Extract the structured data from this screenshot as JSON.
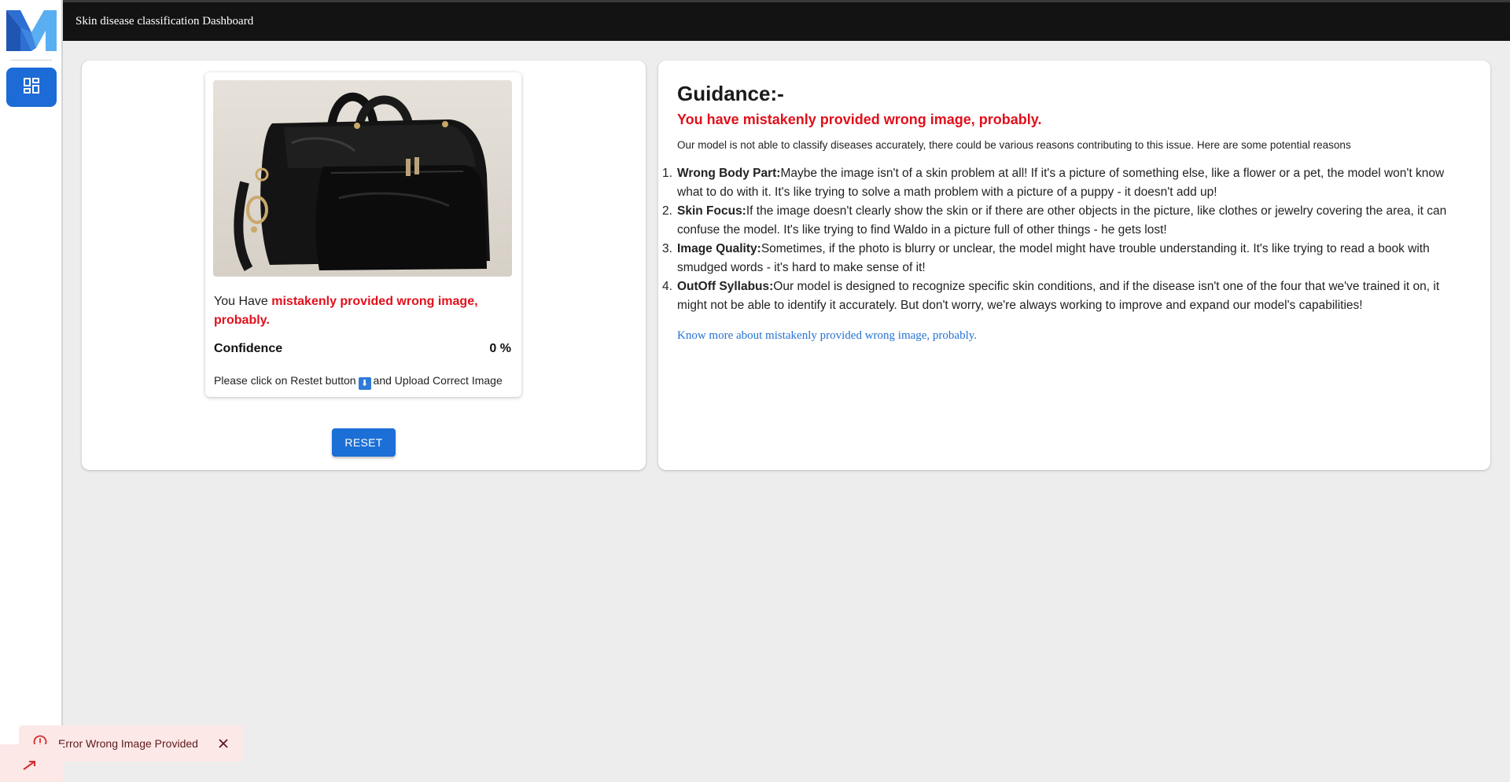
{
  "header": {
    "title": "Skin disease classification Dashboard"
  },
  "sidebar": {
    "logo": "brand-logo",
    "items": [
      {
        "icon": "dashboard-icon",
        "active": true
      }
    ]
  },
  "result_card": {
    "image_alt": "black leather laptop bag",
    "result_prefix": "You Have ",
    "result_highlight": "mistakenly provided wrong image, probably.",
    "confidence_label": "Confidence",
    "confidence_value": "0 %",
    "instruction_before": "Please click on Restet button",
    "instruction_icon": "⬇",
    "instruction_after": "and Upload Correct Image"
  },
  "reset_label": "RESET",
  "guidance": {
    "title": "Guidance:-",
    "subtitle": "You have mistakenly provided wrong image, probably.",
    "intro": "Our model is not able to classify diseases accurately, there could be various reasons contributing to this issue. Here are some potential reasons",
    "reasons": [
      {
        "title": "Wrong Body Part:",
        "text": "Maybe the image isn't of a skin problem at all! If it's a picture of something else, like a flower or a pet, the model won't know what to do with it. It's like trying to solve a math problem with a picture of a puppy - it doesn't add up!"
      },
      {
        "title": "Skin Focus:",
        "text": "If the image doesn't clearly show the skin or if there are other objects in the picture, like clothes or jewelry covering the area, it can confuse the model. It's like trying to find Waldo in a picture full of other things - he gets lost!"
      },
      {
        "title": "Image Quality:",
        "text": "Sometimes, if the photo is blurry or unclear, the model might have trouble understanding it. It's like trying to read a book with smudged words - it's hard to make sense of it!"
      },
      {
        "title": "OutOff Syllabus:",
        "text": "Our model is designed to recognize specific skin conditions, and if the disease isn't one of the four that we've trained it on, it might not be able to identify it accurately. But don't worry, we're always working to improve and expand our model's capabilities!"
      }
    ],
    "know_more": "Know more about mistakenly provided wrong image, probably."
  },
  "toast": {
    "message": "Error Wrong Image Provided",
    "icon": "error-icon"
  },
  "colors": {
    "accent": "#1c6fd6",
    "error": "#e0101b",
    "header_bg": "#131313",
    "link": "#2673d3",
    "toast_bg": "#fde8e8"
  }
}
